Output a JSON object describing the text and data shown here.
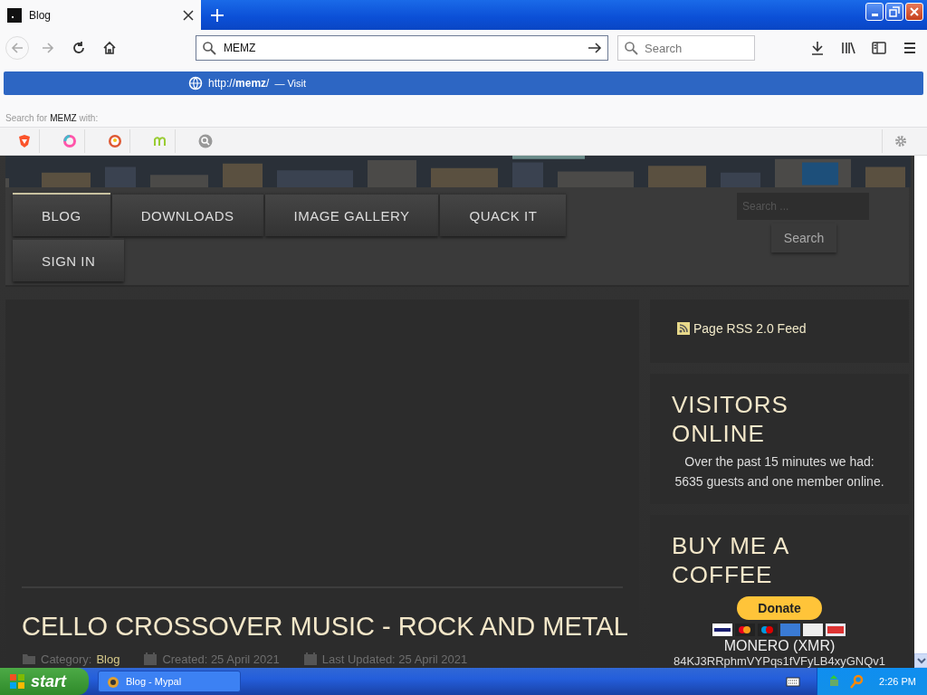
{
  "browser": {
    "tab": {
      "title": "Blog",
      "selected": true
    },
    "url_field": {
      "value": "MEMZ"
    },
    "search_field": {
      "placeholder": "Search"
    },
    "suggestion": {
      "url": "http://**memz**/",
      "dash": "—",
      "action": "Visit",
      "selected": true
    },
    "search_hint": {
      "before": "Search for",
      "term": "MEMZ",
      "after": "with:"
    }
  },
  "site": {
    "menu": [
      {
        "label": "BLOG",
        "selected": true
      },
      {
        "label": "DOWNLOADS",
        "selected": false
      },
      {
        "label": "IMAGE GALLERY",
        "selected": false
      },
      {
        "label": "QUACK IT",
        "selected": false
      },
      {
        "label": "SIGN IN",
        "selected": false
      }
    ],
    "search": {
      "placeholder": "Search ...",
      "button": "Search"
    },
    "article": {
      "title": "CELLO CROSSOVER MUSIC - ROCK AND METAL",
      "category_label": "Category:",
      "category": "Blog",
      "created": "Created: 25 April 2021",
      "updated": "Last Updated: 25 April 2021"
    },
    "sidebar": {
      "rss": "Page RSS 2.0 Feed",
      "visitors": {
        "title": "VISITORS ONLINE",
        "text": "Over the past 15 minutes we had: 5635 guests and one member online."
      },
      "coffee": {
        "title": "BUY ME A COFFEE",
        "donate": "Donate",
        "currency": "MONERO (XMR)",
        "address": "84KJ3RRphmVYPqs1fVFyLB4xyGNQv1"
      }
    }
  },
  "taskbar": {
    "start": "start",
    "tasks": [
      {
        "label": "Blog - Mypal",
        "selected": false
      }
    ],
    "clock": "2:26 PM"
  }
}
